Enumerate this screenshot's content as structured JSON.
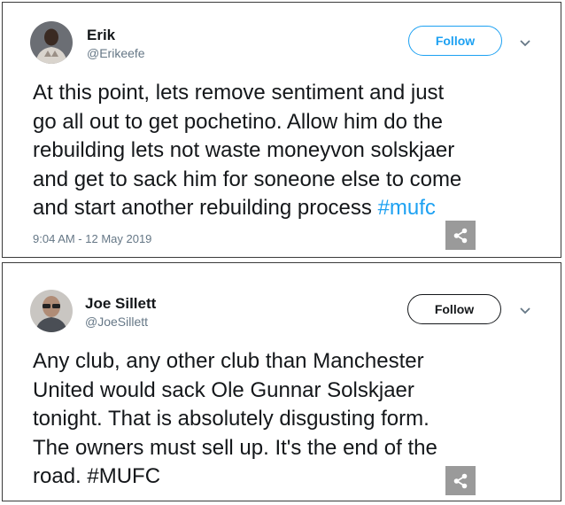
{
  "tweets": [
    {
      "name": "Erik",
      "handle": "@Erikeefe",
      "follow_label": "Follow",
      "text": "At this point, lets remove sentiment and just\ngo all out to get pochetino. Allow him do the\nrebuilding lets not waste moneyvon solskjaer\nand get to sack him for soneone else to come\nand start another rebuilding process ",
      "hashtag": "#mufc",
      "timestamp": "9:04 AM - 12 May 2019"
    },
    {
      "name": "Joe Sillett",
      "handle": "@JoeSillett",
      "follow_label": "Follow",
      "text": "Any club, any other club than Manchester\nUnited would sack Ole Gunnar Solskjaer\ntonight. That is absolutely disgusting form.\nThe owners must sell up. It's the end of the\nroad. #MUFC"
    }
  ],
  "icons": {
    "chevron": "chevron-down-icon",
    "share": "share-icon"
  },
  "colors": {
    "accent": "#1da1f2",
    "text": "#14171a",
    "muted": "#657786",
    "share_bg": "#9a9a9a"
  }
}
